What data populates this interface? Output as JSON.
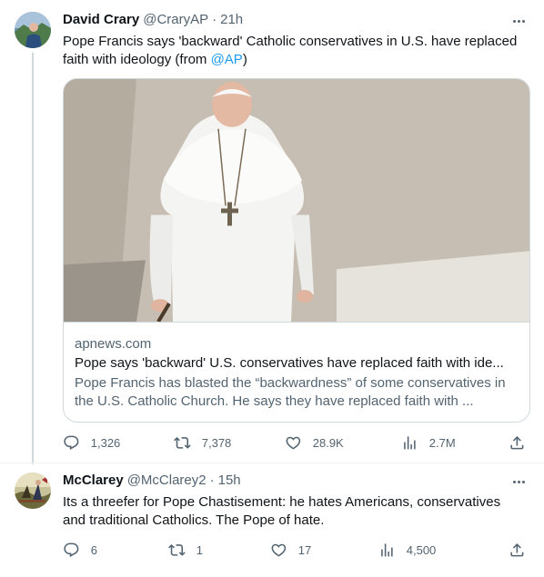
{
  "tweets": [
    {
      "name": "David Crary",
      "handle": "@CraryAP",
      "dot": "·",
      "time": "21h",
      "text_before": "Pope Francis says 'backward' Catholic conservatives in U.S. have replaced faith with ideology (from ",
      "mention": "@AP",
      "text_after": ")",
      "card": {
        "domain": "apnews.com",
        "title": "Pope says 'backward' U.S. conservatives have replaced faith with ide...",
        "description": "Pope Francis has blasted the “backwardness” of some conservatives in the U.S. Catholic Church. He says they have replaced faith with ..."
      },
      "stats": {
        "replies": "1,326",
        "retweets": "7,378",
        "likes": "28.9K",
        "views": "2.7M"
      }
    },
    {
      "name": "McClarey",
      "handle": "@McClarey2",
      "dot": "·",
      "time": "15h",
      "text": "Its a threefer for Pope Chastisement:  he hates Americans, conservatives and traditional Catholics.  The Pope of hate.",
      "stats": {
        "replies": "6",
        "retweets": "1",
        "likes": "17",
        "views": "4,500"
      }
    }
  ],
  "colors": {
    "text": "#0f1419",
    "secondary": "#536471",
    "link": "#1d9bf0",
    "border": "#cfd9de"
  }
}
